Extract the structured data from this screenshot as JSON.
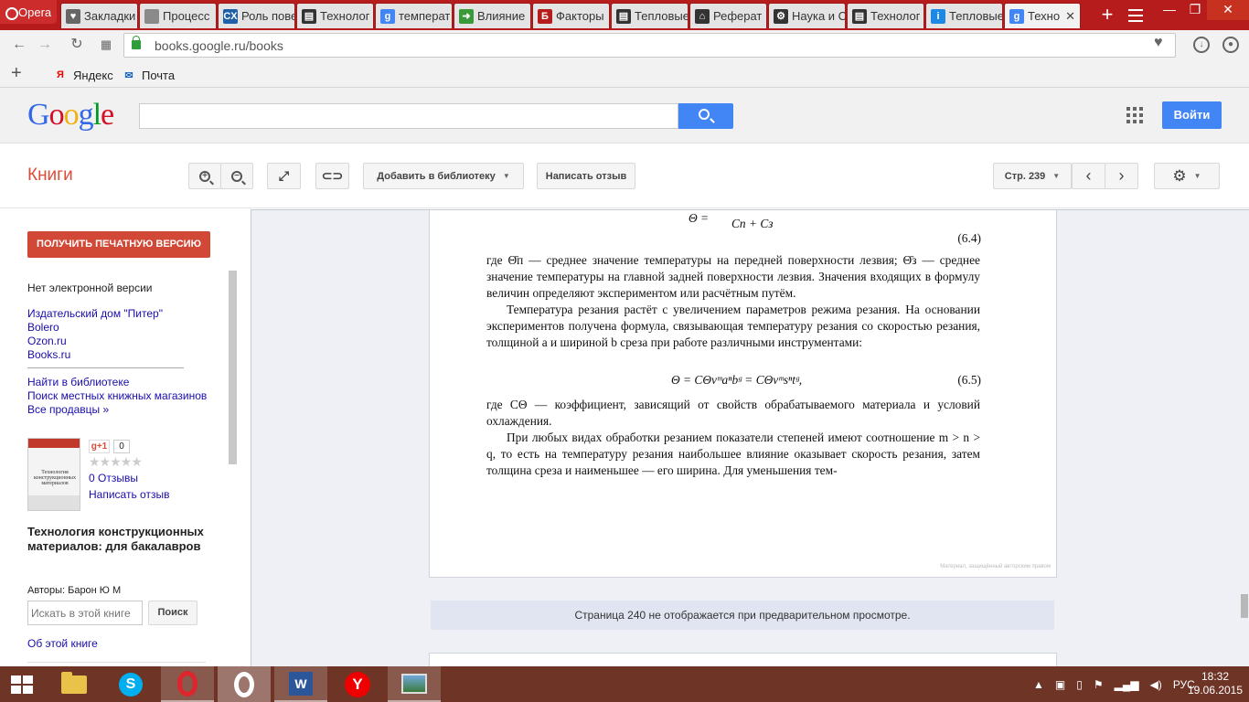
{
  "browser": {
    "menu_label": "Opera",
    "tabs": [
      {
        "title": "Закладки",
        "icon": "heart-icon",
        "color": "#666666",
        "glyph": "♥"
      },
      {
        "title": "Процесс",
        "icon": "page-icon",
        "color": "#8a8a8a",
        "glyph": ""
      },
      {
        "title": "Роль пове",
        "icon": "cx-icon",
        "color": "#1f5fa8",
        "glyph": "CX"
      },
      {
        "title": "Технолог",
        "icon": "book-icon",
        "color": "#333333",
        "glyph": "▤"
      },
      {
        "title": "температ",
        "icon": "google-icon",
        "color": "#4285f4",
        "glyph": "g"
      },
      {
        "title": "Влияние",
        "icon": "arrow-icon",
        "color": "#3a9a3a",
        "glyph": "➜"
      },
      {
        "title": "Факторы",
        "icon": "b-icon",
        "color": "#b71c1c",
        "glyph": "Б"
      },
      {
        "title": "Тепловые",
        "icon": "book-icon",
        "color": "#333333",
        "glyph": "▤"
      },
      {
        "title": "Реферат",
        "icon": "graduation-icon",
        "color": "#333333",
        "glyph": "⌂"
      },
      {
        "title": "Наука и С",
        "icon": "gear-icon",
        "color": "#333333",
        "glyph": "⚙"
      },
      {
        "title": "Технолог",
        "icon": "book-icon",
        "color": "#333333",
        "glyph": "▤"
      },
      {
        "title": "Тепловые",
        "icon": "info-icon",
        "color": "#1e88e5",
        "glyph": "i"
      },
      {
        "title": "Техно",
        "icon": "google-icon",
        "color": "#4285f4",
        "glyph": "g",
        "active": true
      }
    ],
    "url": "books.google.ru/books",
    "bookmarks": [
      {
        "label": "Яндекс",
        "icon": "yandex-icon"
      },
      {
        "label": "Почта",
        "icon": "mail-icon"
      }
    ]
  },
  "google": {
    "logo_letters": [
      "G",
      "o",
      "o",
      "g",
      "l",
      "e"
    ],
    "search_value": "",
    "login_label": "Войти"
  },
  "books": {
    "title": "Книги",
    "toolbar": {
      "add_library": "Добавить в библиотеку",
      "write_review": "Написать отзыв",
      "page_label": "Стр. 239"
    },
    "sidebar": {
      "print_version": "ПОЛУЧИТЬ ПЕЧАТНУЮ ВЕРСИЮ",
      "no_ebook": "Нет электронной версии",
      "sellers": [
        "Издательский дом \"Питер\"",
        "Bolero",
        "Ozon.ru",
        "Books.ru"
      ],
      "library_links": [
        "Найти в библиотеке",
        "Поиск местных книжных магазинов",
        "Все продавцы »"
      ],
      "gplus_label": "g+1",
      "gplus_count": "0",
      "reviews_count": "0 Отзывы",
      "write_review": "Написать отзыв",
      "book_title": "Технология конструкционных материалов: для бакалавров",
      "authors": "Авторы: Барон Ю М",
      "search_placeholder": "Искать в этой книге",
      "search_button": "Поиск",
      "about_book": "Об этой книге",
      "cover_text": "Технология конструкционных материалов"
    },
    "page": {
      "formula_top_lhs": "Θ =",
      "formula_top_den": "Cп + Cз",
      "eq1_number": "(6.4)",
      "para1": "где Θ̄п — среднее значение температуры на передней поверхности лезвия; Θ̄з — среднее значение температуры на главной задней поверхности лезвия. Значения входящих в формулу величин определяют экспериментом или расчётным путём.",
      "para2": "Температура резания растёт с увеличением параметров режима резания. На основании экспериментов получена формула, связывающая температуру резания со скоростью резания, толщиной a и шириной b среза при работе различными инструментами:",
      "formula2": "Θ = CΘvᵐaⁿbᵍ = CΘvᵐsⁿtᵍ,",
      "eq2_number": "(6.5)",
      "para3": "где CΘ — коэффициент, зависящий от свойств обрабатываемого материала и условий охлаждения.",
      "para4": "При любых видах обработки резанием показатели степеней имеют соотношение m > n > q, то есть на температуру резания наибольшее влияние оказывает скорость резания, затем толщина среза и наименьшее — его ширина. Для уменьшения тем-",
      "watermark": "Материал, защищённый авторским правом"
    },
    "notice": "Страница 240 не отображается при предварительном просмотре."
  },
  "taskbar": {
    "language": "РУС",
    "time": "18:32",
    "date": "19.06.2015"
  }
}
